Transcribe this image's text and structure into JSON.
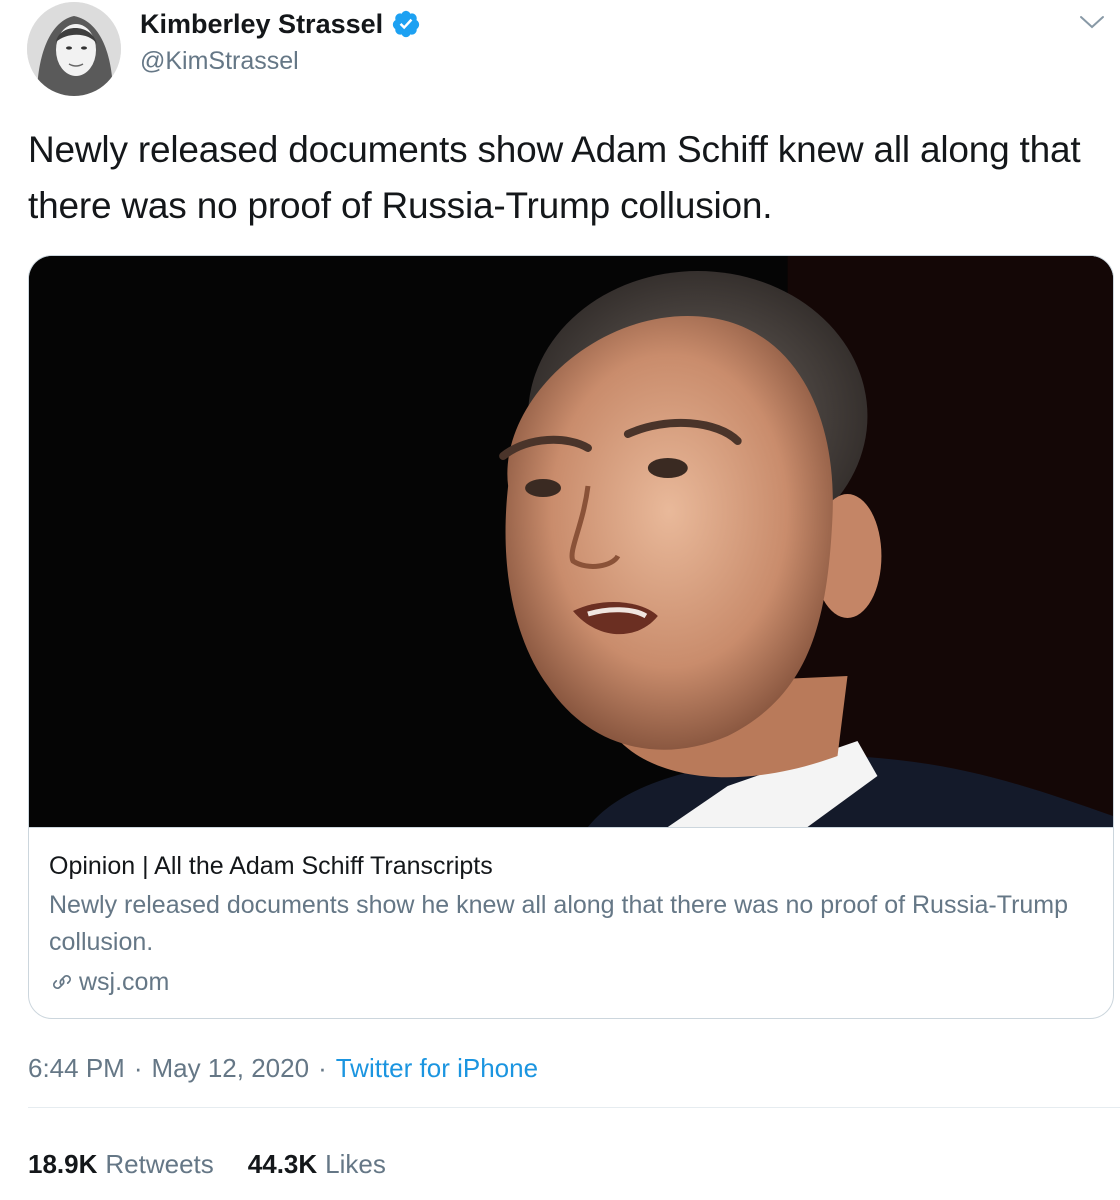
{
  "tweet": {
    "author": {
      "display_name": "Kimberley Strassel",
      "handle": "@KimStrassel",
      "verified": true,
      "avatar_icon": "profile-photo"
    },
    "text": "Newly released documents show Adam Schiff knew all along that there was no proof of Russia-Trump collusion.",
    "card": {
      "image_icon": "photo",
      "title": "Opinion | All the Adam Schiff Transcripts",
      "description": "Newly released documents show he knew all along that there was no proof of Russia-Trump collusion.",
      "domain": "wsj.com",
      "domain_icon": "link-icon"
    },
    "meta": {
      "time": "6:44 PM",
      "separator": "·",
      "date": "May 12, 2020",
      "source": "Twitter for iPhone"
    },
    "stats": {
      "retweets_count": "18.9K",
      "retweets_label": "Retweets",
      "likes_count": "44.3K",
      "likes_label": "Likes"
    }
  },
  "colors": {
    "text_primary": "#14171a",
    "text_secondary": "#657786",
    "link_blue": "#1b95e0",
    "verified_blue": "#1da1f2",
    "border": "#ccd6dd"
  }
}
